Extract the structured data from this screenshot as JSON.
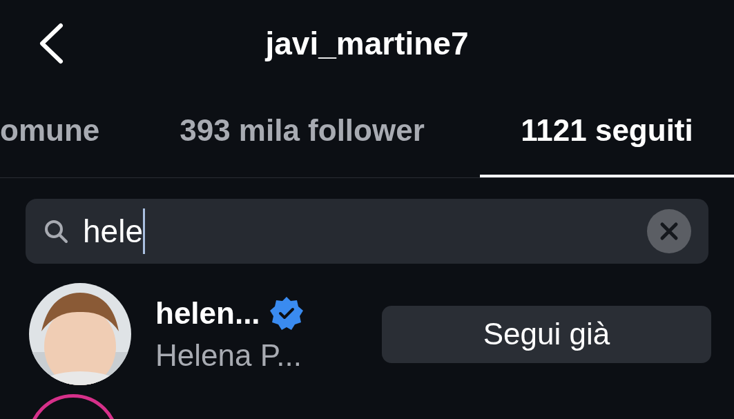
{
  "header": {
    "title": "javi_martine7"
  },
  "tabs": [
    {
      "label": "omune",
      "selected": false
    },
    {
      "label": "393 mila follower",
      "selected": false
    },
    {
      "label": "1121 seguiti",
      "selected": true
    }
  ],
  "search": {
    "value": "hele"
  },
  "results": [
    {
      "username": "helen...",
      "verified": true,
      "full_name": "Helena P...",
      "button": "Segui già"
    }
  ]
}
